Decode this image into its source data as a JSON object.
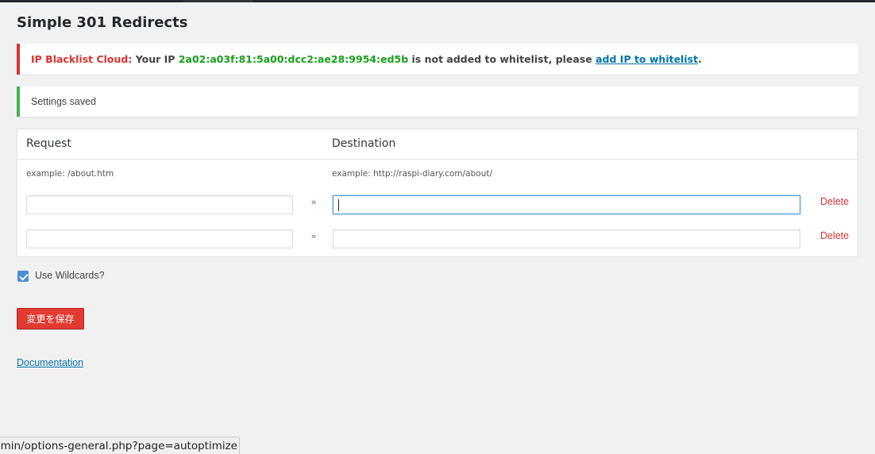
{
  "page": {
    "title": "Simple 301 Redirects"
  },
  "notices": {
    "blacklist": {
      "label": "IP Blacklist Cloud",
      "colon": ":",
      "text_before_ip": " Your IP ",
      "ip": "2a02:a03f:81:5a00:dcc2:ae28:9954:ed5b",
      "text_after_ip": " is not added to whitelist, please ",
      "link_text": "add IP to whitelist",
      "period": "."
    },
    "settings_saved": "Settings saved"
  },
  "redirects": {
    "headers": {
      "request": "Request",
      "destination": "Destination"
    },
    "examples": {
      "request": "example: /about.htm",
      "destination": "example: http://raspi-diary.com/about/"
    },
    "arrow": "»",
    "delete_label": "Delete",
    "rows": [
      {
        "request": "",
        "destination": "",
        "focused": true
      },
      {
        "request": "",
        "destination": "",
        "focused": false
      }
    ]
  },
  "options": {
    "wildcards_label": "Use Wildcards?",
    "wildcards_checked": true
  },
  "actions": {
    "save_label": "変更を保存",
    "documentation_label": "Documentation"
  },
  "status_bar": {
    "url": "min/options-general.php?page=autoptimize"
  },
  "colors": {
    "error_border": "#dc3232",
    "success_border": "#46b450",
    "ip_green": "#17a11b",
    "link_blue": "#0073aa",
    "save_button": "#e03a31",
    "checkbox_blue": "#4a90d2"
  },
  "icons": {
    "checkbox": "checkmark-icon"
  }
}
